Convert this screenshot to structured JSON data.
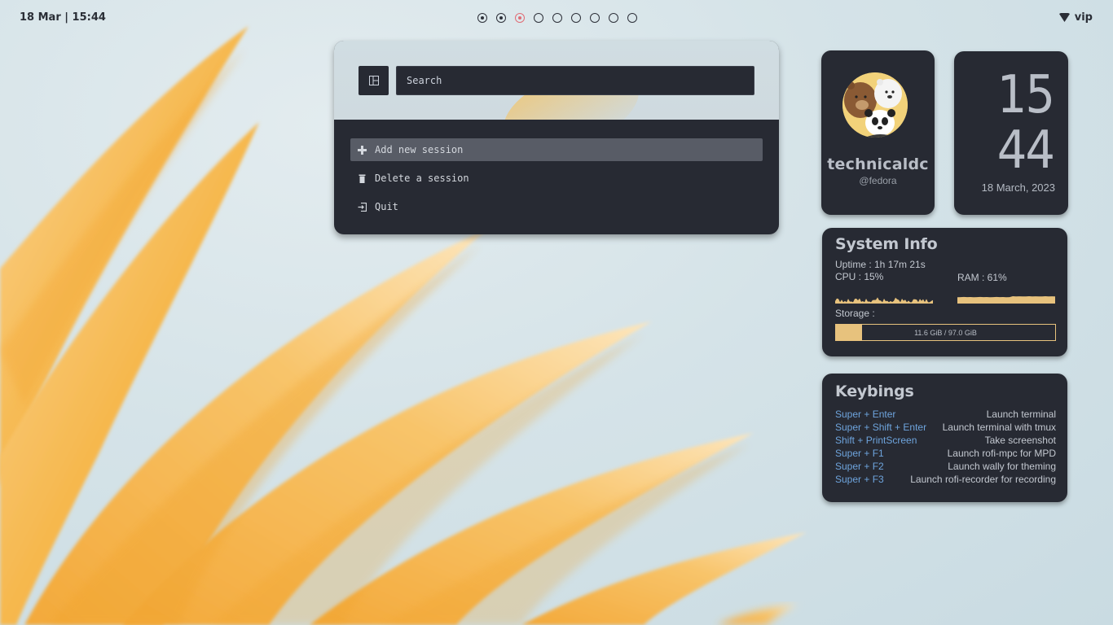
{
  "topbar": {
    "datetime": "18 Mar | 15:44",
    "workspaces": [
      {
        "state": "occupied"
      },
      {
        "state": "occupied"
      },
      {
        "state": "active"
      },
      {
        "state": "empty"
      },
      {
        "state": "empty"
      },
      {
        "state": "empty"
      },
      {
        "state": "empty"
      },
      {
        "state": "empty"
      },
      {
        "state": "empty"
      }
    ],
    "wifi_icon": "wifi-icon",
    "network_name": "vip"
  },
  "launcher": {
    "layout_icon": "layout-icon",
    "search_placeholder": "Search",
    "items": [
      {
        "icon": "plus-icon",
        "label": "Add new session",
        "selected": true
      },
      {
        "icon": "trash-icon",
        "label": "Delete a session",
        "selected": false
      },
      {
        "icon": "exit-icon",
        "label": "Quit",
        "selected": false
      }
    ]
  },
  "profile": {
    "name": "technicaldc",
    "handle": "@fedora"
  },
  "clock": {
    "hour": "15",
    "minute": "44",
    "date": "18 March, 2023"
  },
  "sysinfo": {
    "title": "System Info",
    "uptime": "Uptime : 1h 17m 21s",
    "cpu_label": "CPU : 15%",
    "cpu_percent": 15,
    "ram_label": "RAM : 61%",
    "ram_percent": 61,
    "storage_label": "Storage :",
    "storage_text": "11.6 GiB / 97.0 GiB",
    "storage_used": 11.6,
    "storage_total": 97.0
  },
  "keybinds": {
    "title": "Keybings",
    "rows": [
      {
        "key": "Super + Enter",
        "action": "Launch terminal"
      },
      {
        "key": "Super + Shift + Enter",
        "action": "Launch terminal with tmux"
      },
      {
        "key": "Shift + PrintScreen",
        "action": "Take screenshot"
      },
      {
        "key": "Super + F1",
        "action": "Launch rofi-mpc for MPD"
      },
      {
        "key": "Super + F2",
        "action": "Launch wally for theming"
      },
      {
        "key": "Super + F3",
        "action": "Launch rofi-recorder for recording"
      }
    ]
  },
  "colors": {
    "card_bg": "#272a33",
    "accent_gold": "#e7c27d",
    "key_blue": "#6ea4dd",
    "active_workspace": "#e06c75"
  }
}
